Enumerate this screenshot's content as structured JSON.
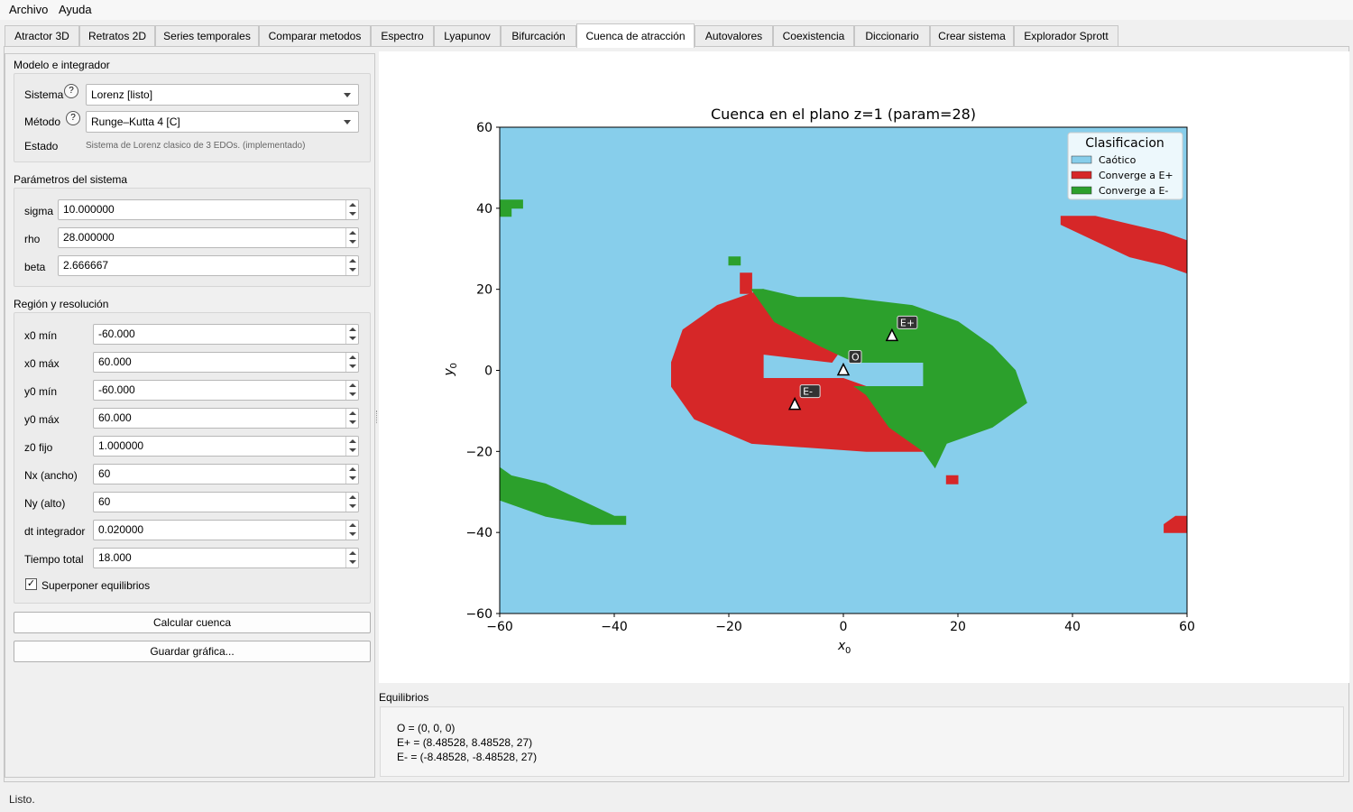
{
  "menu": [
    "Archivo",
    "Ayuda"
  ],
  "tabs": [
    "Atractor 3D",
    "Retratos 2D",
    "Series temporales",
    "Comparar metodos",
    "Espectro",
    "Lyapunov",
    "Bifurcación",
    "Cuenca de atracción",
    "Autovalores",
    "Coexistencia",
    "Diccionario",
    "Crear sistema",
    "Explorador Sprott"
  ],
  "active_tab": "Cuenca de atracción",
  "model": {
    "title": "Modelo e integrador",
    "sistema_label": "Sistema",
    "sistema_value": "Lorenz [listo]",
    "metodo_label": "Método",
    "metodo_value": "Runge–Kutta 4 [C]",
    "estado_label": "Estado",
    "estado_value": "Sistema de Lorenz clasico de 3 EDOs. (implementado)",
    "help_glyph": "?"
  },
  "params": {
    "title": "Parámetros del sistema",
    "fields": [
      {
        "label": "sigma",
        "value": "10.000000"
      },
      {
        "label": "rho",
        "value": "28.000000"
      },
      {
        "label": "beta",
        "value": "2.666667"
      }
    ]
  },
  "region": {
    "title": "Región y resolución",
    "fields": [
      {
        "label": "x0 mín",
        "value": "-60.000"
      },
      {
        "label": "x0 máx",
        "value": "60.000"
      },
      {
        "label": "y0 mín",
        "value": "-60.000"
      },
      {
        "label": "y0 máx",
        "value": "60.000"
      },
      {
        "label": "z0 fijo",
        "value": "1.000000"
      },
      {
        "label": "Nx (ancho)",
        "value": "60"
      },
      {
        "label": "Ny (alto)",
        "value": "60"
      },
      {
        "label": "dt integrador",
        "value": "0.020000"
      },
      {
        "label": "Tiempo total",
        "value": "18.000"
      }
    ],
    "overlay_label": "Superponer equilibrios",
    "overlay_checked": true
  },
  "buttons": {
    "calc": "Calcular cuenca",
    "save": "Guardar gráfica..."
  },
  "equilibria": {
    "title": "Equilibrios",
    "lines": [
      "O = (0, 0, 0)",
      "E+ = (8.48528, 8.48528, 27)",
      "E- = (-8.48528, -8.48528, 27)"
    ]
  },
  "status": "Listo.",
  "colors": {
    "chaotic": "#87ceeb",
    "eplus": "#d62728",
    "eminus": "#2ca02c"
  },
  "chart_data": {
    "type": "heatmap",
    "title": "Cuenca en el plano z=1 (param=28)",
    "xlabel": "x",
    "xlabel_sub": "0",
    "ylabel": "y",
    "ylabel_sub": "0",
    "xlim": [
      -60,
      60
    ],
    "ylim": [
      -60,
      60
    ],
    "xticks": [
      -60,
      -40,
      -20,
      0,
      20,
      40,
      60
    ],
    "yticks": [
      -60,
      -40,
      -20,
      0,
      20,
      40,
      60
    ],
    "grid": false,
    "legend_title": "Clasificacion",
    "legend_position": "top-right",
    "classes": [
      {
        "name": "Caótico",
        "color": "#87ceeb"
      },
      {
        "name": "Converge a E+",
        "color": "#d62728"
      },
      {
        "name": "Converge a E-",
        "color": "#2ca02c"
      }
    ],
    "background_class": "Caótico",
    "regions": [
      {
        "class": "Converge a E+",
        "polygon": [
          [
            -30,
            2
          ],
          [
            -28,
            10
          ],
          [
            -22,
            16
          ],
          [
            -14,
            20
          ],
          [
            -6,
            12
          ],
          [
            0,
            6
          ],
          [
            -2,
            2
          ],
          [
            -14,
            4
          ],
          [
            -14,
            -2
          ],
          [
            -8,
            -2
          ],
          [
            0,
            -2
          ],
          [
            8,
            -6
          ],
          [
            14,
            -14
          ],
          [
            14,
            -20
          ],
          [
            4,
            -20
          ],
          [
            -16,
            -18
          ],
          [
            -26,
            -12
          ],
          [
            -30,
            -4
          ]
        ]
      },
      {
        "class": "Converge a E+",
        "polygon": [
          [
            -18,
            24
          ],
          [
            -16,
            24
          ],
          [
            -16,
            19
          ],
          [
            -18,
            19
          ]
        ]
      },
      {
        "class": "Converge a E+",
        "polygon": [
          [
            38,
            38
          ],
          [
            44,
            38
          ],
          [
            50,
            36
          ],
          [
            56,
            34
          ],
          [
            60,
            32
          ],
          [
            60,
            24
          ],
          [
            56,
            26
          ],
          [
            50,
            28
          ],
          [
            44,
            32
          ],
          [
            38,
            36
          ]
        ]
      },
      {
        "class": "Converge a E+",
        "polygon": [
          [
            18,
            -26
          ],
          [
            20,
            -26
          ],
          [
            20,
            -28
          ],
          [
            18,
            -28
          ]
        ]
      },
      {
        "class": "Converge a E+",
        "polygon": [
          [
            56,
            -40
          ],
          [
            60,
            -40
          ],
          [
            60,
            -36
          ],
          [
            58,
            -36
          ],
          [
            56,
            -38
          ]
        ]
      },
      {
        "class": "Converge a E-",
        "polygon": [
          [
            -14,
            20
          ],
          [
            -8,
            18
          ],
          [
            0,
            18
          ],
          [
            12,
            16
          ],
          [
            20,
            12
          ],
          [
            26,
            6
          ],
          [
            30,
            0
          ],
          [
            32,
            -8
          ],
          [
            26,
            -14
          ],
          [
            18,
            -18
          ],
          [
            16,
            -24
          ],
          [
            14,
            -20
          ],
          [
            8,
            -14
          ],
          [
            4,
            -6
          ],
          [
            2,
            -4
          ],
          [
            14,
            -4
          ],
          [
            14,
            2
          ],
          [
            2,
            2
          ],
          [
            -4,
            6
          ],
          [
            -12,
            12
          ],
          [
            -16,
            20
          ]
        ]
      },
      {
        "class": "Converge a E-",
        "polygon": [
          [
            -20,
            28
          ],
          [
            -18,
            28
          ],
          [
            -18,
            26
          ],
          [
            -20,
            26
          ]
        ]
      },
      {
        "class": "Converge a E-",
        "polygon": [
          [
            -60,
            42
          ],
          [
            -56,
            42
          ],
          [
            -56,
            40
          ],
          [
            -58,
            40
          ],
          [
            -58,
            38
          ],
          [
            -60,
            38
          ]
        ]
      },
      {
        "class": "Converge a E-",
        "polygon": [
          [
            -60,
            -24
          ],
          [
            -58,
            -26
          ],
          [
            -52,
            -28
          ],
          [
            -46,
            -32
          ],
          [
            -40,
            -36
          ],
          [
            -38,
            -36
          ],
          [
            -38,
            -38
          ],
          [
            -44,
            -38
          ],
          [
            -52,
            -36
          ],
          [
            -60,
            -32
          ]
        ]
      }
    ],
    "markers": [
      {
        "label": "O",
        "x": 0,
        "y": 0
      },
      {
        "label": "E+",
        "x": 8.48528,
        "y": 8.48528
      },
      {
        "label": "E-",
        "x": -8.48528,
        "y": -8.48528
      }
    ]
  }
}
